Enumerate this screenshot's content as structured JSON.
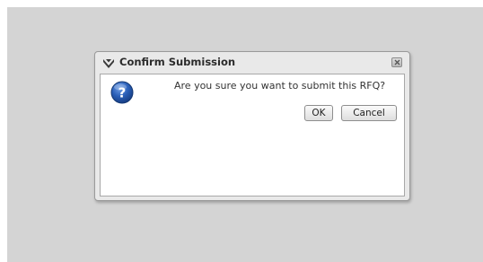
{
  "dialog": {
    "title": "Confirm Submission",
    "message": "Are you sure you want to submit this RFQ?",
    "ok_label": "OK",
    "cancel_label": "Cancel"
  },
  "icons": {
    "title": "chevron-logo-icon",
    "close": "close-icon",
    "message": "question-icon"
  },
  "colors": {
    "backdrop": "#d4d4d4",
    "dialog_frame": "#e9e9e9",
    "question_icon": "#1f56a8"
  }
}
